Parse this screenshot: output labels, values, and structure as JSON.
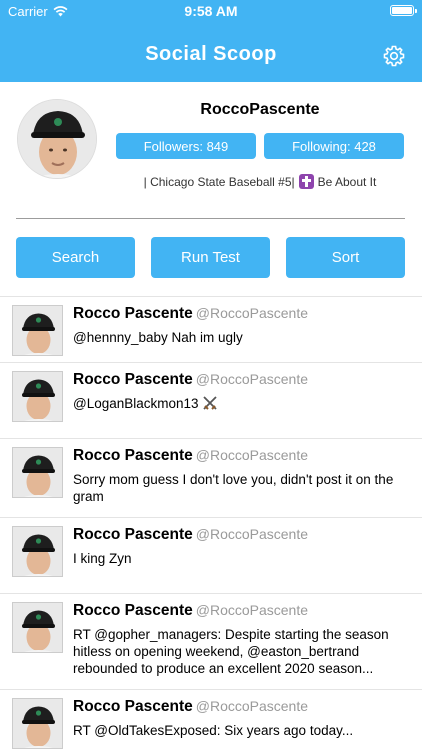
{
  "status_bar": {
    "carrier": "Carrier",
    "time": "9:58 AM"
  },
  "nav": {
    "title": "Social Scoop",
    "settings_icon": "gear-icon"
  },
  "profile": {
    "username": "RoccoPascente",
    "followers_label": "Followers: 849",
    "following_label": "Following: 428",
    "bio_prefix": "| Chicago State Baseball #5|",
    "bio_suffix": "Be About It"
  },
  "actions": {
    "search": "Search",
    "run_test": "Run Test",
    "sort": "Sort"
  },
  "colors": {
    "accent": "#42b4f3",
    "handle": "#9a9a9a"
  },
  "tweets": [
    {
      "name": "Rocco Pascente",
      "handle": "@RoccoPascente",
      "text": "@hennny_baby Nah im ugly"
    },
    {
      "name": "Rocco Pascente",
      "handle": "@RoccoPascente",
      "text": "@LoganBlackmon13"
    },
    {
      "name": "Rocco Pascente",
      "handle": "@RoccoPascente",
      "text": "Sorry mom guess I don't love you, didn't post it on the gram"
    },
    {
      "name": "Rocco Pascente",
      "handle": "@RoccoPascente",
      "text": "I king Zyn"
    },
    {
      "name": "Rocco Pascente",
      "handle": "@RoccoPascente",
      "text": "RT @gopher_managers: Despite starting the season hitless on opening weekend, @easton_bertrand rebounded to produce an excellent 2020 season..."
    },
    {
      "name": "Rocco Pascente",
      "handle": "@RoccoPascente",
      "text": "RT @OldTakesExposed: Six years ago today..."
    }
  ]
}
